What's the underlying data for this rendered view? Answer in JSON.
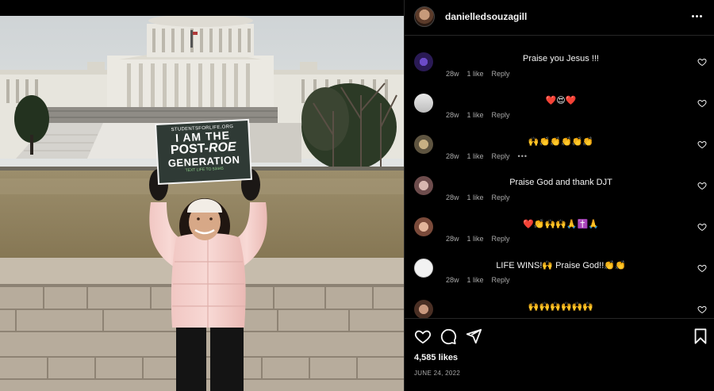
{
  "post": {
    "username": "danielledsouzagill",
    "likes": "4,585 likes",
    "date": "JUNE 24, 2022"
  },
  "sign": {
    "org": "STUDENTSFORLIFE.ORG",
    "line1": "I AM THE",
    "line2a": "POST-",
    "line2b": "ROE",
    "line3": "GENERATION",
    "footer": "TEXT LIFE TO 53445"
  },
  "comments": [
    {
      "text": "Praise you Jesus !!!",
      "age": "28w",
      "likes": "1 like",
      "reply": "Reply",
      "avatar_color": "#3b2a6b"
    },
    {
      "text": "❤️😍❤️",
      "age": "28w",
      "likes": "1 like",
      "reply": "Reply",
      "avatar_color": "#c9c9c9"
    },
    {
      "text": "🙌👏👏👏👏👏",
      "age": "28w",
      "likes": "1 like",
      "reply": "Reply",
      "more": "•••",
      "avatar_color": "#8a7a5a"
    },
    {
      "text": "Praise God and thank DJT",
      "age": "28w",
      "likes": "1 like",
      "reply": "Reply",
      "avatar_color": "#a58a8a"
    },
    {
      "text": "❤️👏🙌🙌🙏✝️🙏",
      "age": "28w",
      "likes": "1 like",
      "reply": "Reply",
      "avatar_color": "#b08070"
    },
    {
      "text": "LIFE WINS!🙌 Praise God!!👏👏",
      "age": "28w",
      "likes": "1 like",
      "reply": "Reply",
      "avatar_color": "#e8e8e8"
    },
    {
      "text": "🙌🙌🙌🙌🙌🙌",
      "age": "",
      "likes": "",
      "reply": "",
      "avatar_color": "#7a5a4a"
    }
  ],
  "icons": {
    "like": "heart-icon",
    "comment": "comment-icon",
    "share": "share-icon",
    "save": "bookmark-icon",
    "more": "more-options-icon"
  }
}
